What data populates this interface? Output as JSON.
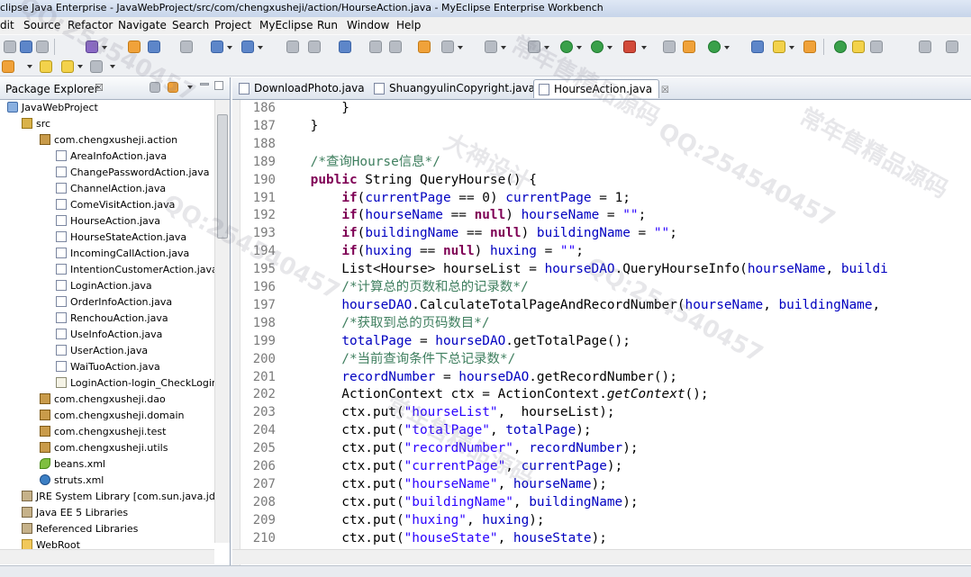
{
  "window": {
    "title": "clipse Java Enterprise - JavaWebProject/src/com/chengxusheji/action/HourseAction.java - MyEclipse Enterprise Workbench"
  },
  "menu": [
    "dit",
    "Source",
    "Refactor",
    "Navigate",
    "Search",
    "Project",
    "MyEclipse",
    "Run",
    "Window",
    "Help"
  ],
  "explorer": {
    "title": "Package Explorer",
    "close": "☒",
    "items": [
      {
        "label": "JavaWebProject",
        "icon": "project-icon",
        "indent": 0
      },
      {
        "label": "src",
        "icon": "source-folder-icon",
        "indent": 1
      },
      {
        "label": "com.chengxusheji.action",
        "icon": "package-icon",
        "indent": 2
      },
      {
        "label": "AreaInfoAction.java",
        "icon": "java-file-icon",
        "indent": 3
      },
      {
        "label": "ChangePasswordAction.java",
        "icon": "java-file-icon",
        "indent": 3
      },
      {
        "label": "ChannelAction.java",
        "icon": "java-file-icon",
        "indent": 3
      },
      {
        "label": "ComeVisitAction.java",
        "icon": "java-file-icon",
        "indent": 3
      },
      {
        "label": "HourseAction.java",
        "icon": "java-file-icon",
        "indent": 3
      },
      {
        "label": "HourseStateAction.java",
        "icon": "java-file-icon",
        "indent": 3
      },
      {
        "label": "IncomingCallAction.java",
        "icon": "java-file-icon",
        "indent": 3
      },
      {
        "label": "IntentionCustomerAction.java",
        "icon": "java-file-icon",
        "indent": 3
      },
      {
        "label": "LoginAction.java",
        "icon": "java-file-icon",
        "indent": 3
      },
      {
        "label": "OrderInfoAction.java",
        "icon": "java-file-icon",
        "indent": 3
      },
      {
        "label": "RenchouAction.java",
        "icon": "java-file-icon",
        "indent": 3
      },
      {
        "label": "UseInfoAction.java",
        "icon": "java-file-icon",
        "indent": 3
      },
      {
        "label": "UserAction.java",
        "icon": "java-file-icon",
        "indent": 3
      },
      {
        "label": "WaiTuoAction.java",
        "icon": "java-file-icon",
        "indent": 3
      },
      {
        "label": "LoginAction-login_CheckLogin",
        "icon": "xml-file-icon",
        "indent": 3
      },
      {
        "label": "com.chengxusheji.dao",
        "icon": "package-icon",
        "indent": 2
      },
      {
        "label": "com.chengxusheji.domain",
        "icon": "package-icon",
        "indent": 2
      },
      {
        "label": "com.chengxusheji.test",
        "icon": "package-icon",
        "indent": 2
      },
      {
        "label": "com.chengxusheji.utils",
        "icon": "package-icon",
        "indent": 2
      },
      {
        "label": "beans.xml",
        "icon": "bean-icon",
        "indent": 2
      },
      {
        "label": "struts.xml",
        "icon": "gear-icon",
        "indent": 2
      },
      {
        "label": "JRE System Library [com.sun.java.jdk.",
        "icon": "library-icon",
        "indent": 1
      },
      {
        "label": "Java EE 5 Libraries",
        "icon": "library-icon",
        "indent": 1
      },
      {
        "label": "Referenced Libraries",
        "icon": "library-icon",
        "indent": 1
      },
      {
        "label": "WebRoot",
        "icon": "folder-icon",
        "indent": 1
      }
    ]
  },
  "editor": {
    "tabs": [
      {
        "label": "DownloadPhoto.java",
        "active": false
      },
      {
        "label": "ShuangyulinCopyright.java",
        "active": false
      },
      {
        "label": "HourseAction.java",
        "active": true,
        "close": "☒"
      }
    ],
    "line_numbers": [
      "186",
      "187",
      "188",
      "189",
      "190",
      "191",
      "192",
      "193",
      "194",
      "195",
      "196",
      "197",
      "198",
      "199",
      "200",
      "201",
      "202",
      "203",
      "204",
      "205",
      "206",
      "207",
      "208",
      "209",
      "210"
    ],
    "lines": [
      [
        {
          "t": "        }",
          "c": ""
        }
      ],
      [
        {
          "t": "    }",
          "c": ""
        }
      ],
      [
        {
          "t": "",
          "c": ""
        }
      ],
      [
        {
          "t": "    /*查询Hourse信息*/",
          "c": "cmt"
        }
      ],
      [
        {
          "t": "    ",
          "c": ""
        },
        {
          "t": "public",
          "c": "kw"
        },
        {
          "t": " String QueryHourse() {",
          "c": ""
        }
      ],
      [
        {
          "t": "        ",
          "c": ""
        },
        {
          "t": "if",
          "c": "kw"
        },
        {
          "t": "(",
          "c": ""
        },
        {
          "t": "currentPage",
          "c": "fld"
        },
        {
          "t": " == 0) ",
          "c": ""
        },
        {
          "t": "currentPage",
          "c": "fld"
        },
        {
          "t": " = 1;",
          "c": ""
        }
      ],
      [
        {
          "t": "        ",
          "c": ""
        },
        {
          "t": "if",
          "c": "kw"
        },
        {
          "t": "(",
          "c": ""
        },
        {
          "t": "hourseName",
          "c": "fld"
        },
        {
          "t": " == ",
          "c": ""
        },
        {
          "t": "null",
          "c": "kw"
        },
        {
          "t": ") ",
          "c": ""
        },
        {
          "t": "hourseName",
          "c": "fld"
        },
        {
          "t": " = ",
          "c": ""
        },
        {
          "t": "\"\"",
          "c": "str"
        },
        {
          "t": ";",
          "c": ""
        }
      ],
      [
        {
          "t": "        ",
          "c": ""
        },
        {
          "t": "if",
          "c": "kw"
        },
        {
          "t": "(",
          "c": ""
        },
        {
          "t": "buildingName",
          "c": "fld"
        },
        {
          "t": " == ",
          "c": ""
        },
        {
          "t": "null",
          "c": "kw"
        },
        {
          "t": ") ",
          "c": ""
        },
        {
          "t": "buildingName",
          "c": "fld"
        },
        {
          "t": " = ",
          "c": ""
        },
        {
          "t": "\"\"",
          "c": "str"
        },
        {
          "t": ";",
          "c": ""
        }
      ],
      [
        {
          "t": "        ",
          "c": ""
        },
        {
          "t": "if",
          "c": "kw"
        },
        {
          "t": "(",
          "c": ""
        },
        {
          "t": "huxing",
          "c": "fld"
        },
        {
          "t": " == ",
          "c": ""
        },
        {
          "t": "null",
          "c": "kw"
        },
        {
          "t": ") ",
          "c": ""
        },
        {
          "t": "huxing",
          "c": "fld"
        },
        {
          "t": " = ",
          "c": ""
        },
        {
          "t": "\"\"",
          "c": "str"
        },
        {
          "t": ";",
          "c": ""
        }
      ],
      [
        {
          "t": "        List<Hourse> hourseList = ",
          "c": ""
        },
        {
          "t": "hourseDAO",
          "c": "fld"
        },
        {
          "t": ".QueryHourseInfo(",
          "c": ""
        },
        {
          "t": "hourseName",
          "c": "fld"
        },
        {
          "t": ", ",
          "c": ""
        },
        {
          "t": "buildi",
          "c": "fld"
        }
      ],
      [
        {
          "t": "        /*计算总的页数和总的记录数*/",
          "c": "cmt"
        }
      ],
      [
        {
          "t": "        ",
          "c": ""
        },
        {
          "t": "hourseDAO",
          "c": "fld"
        },
        {
          "t": ".CalculateTotalPageAndRecordNumber(",
          "c": ""
        },
        {
          "t": "hourseName",
          "c": "fld"
        },
        {
          "t": ", ",
          "c": ""
        },
        {
          "t": "buildingName",
          "c": "fld"
        },
        {
          "t": ",",
          "c": ""
        }
      ],
      [
        {
          "t": "        /*获取到总的页码数目*/",
          "c": "cmt"
        }
      ],
      [
        {
          "t": "        ",
          "c": ""
        },
        {
          "t": "totalPage",
          "c": "fld"
        },
        {
          "t": " = ",
          "c": ""
        },
        {
          "t": "hourseDAO",
          "c": "fld"
        },
        {
          "t": ".getTotalPage();",
          "c": ""
        }
      ],
      [
        {
          "t": "        /*当前查询条件下总记录数*/",
          "c": "cmt"
        }
      ],
      [
        {
          "t": "        ",
          "c": ""
        },
        {
          "t": "recordNumber",
          "c": "fld"
        },
        {
          "t": " = ",
          "c": ""
        },
        {
          "t": "hourseDAO",
          "c": "fld"
        },
        {
          "t": ".getRecordNumber();",
          "c": ""
        }
      ],
      [
        {
          "t": "        ActionContext ctx = ActionContext.",
          "c": ""
        },
        {
          "t": "getContext",
          "c": "it"
        },
        {
          "t": "();",
          "c": ""
        }
      ],
      [
        {
          "t": "        ctx.put(",
          "c": ""
        },
        {
          "t": "\"hourseList\"",
          "c": "str"
        },
        {
          "t": ",  hourseList);",
          "c": ""
        }
      ],
      [
        {
          "t": "        ctx.put(",
          "c": ""
        },
        {
          "t": "\"totalPage\"",
          "c": "str"
        },
        {
          "t": ", ",
          "c": ""
        },
        {
          "t": "totalPage",
          "c": "fld"
        },
        {
          "t": ");",
          "c": ""
        }
      ],
      [
        {
          "t": "        ctx.put(",
          "c": ""
        },
        {
          "t": "\"recordNumber\"",
          "c": "str"
        },
        {
          "t": ", ",
          "c": ""
        },
        {
          "t": "recordNumber",
          "c": "fld"
        },
        {
          "t": ");",
          "c": ""
        }
      ],
      [
        {
          "t": "        ctx.put(",
          "c": ""
        },
        {
          "t": "\"currentPage\"",
          "c": "str"
        },
        {
          "t": ", ",
          "c": ""
        },
        {
          "t": "currentPage",
          "c": "fld"
        },
        {
          "t": ");",
          "c": ""
        }
      ],
      [
        {
          "t": "        ctx.put(",
          "c": ""
        },
        {
          "t": "\"hourseName\"",
          "c": "str"
        },
        {
          "t": ", ",
          "c": ""
        },
        {
          "t": "hourseName",
          "c": "fld"
        },
        {
          "t": ");",
          "c": ""
        }
      ],
      [
        {
          "t": "        ctx.put(",
          "c": ""
        },
        {
          "t": "\"buildingName\"",
          "c": "str"
        },
        {
          "t": ", ",
          "c": ""
        },
        {
          "t": "buildingName",
          "c": "fld"
        },
        {
          "t": ");",
          "c": ""
        }
      ],
      [
        {
          "t": "        ctx.put(",
          "c": ""
        },
        {
          "t": "\"huxing\"",
          "c": "str"
        },
        {
          "t": ", ",
          "c": ""
        },
        {
          "t": "huxing",
          "c": "fld"
        },
        {
          "t": ");",
          "c": ""
        }
      ],
      [
        {
          "t": "        ctx.put(",
          "c": ""
        },
        {
          "t": "\"houseState\"",
          "c": "str"
        },
        {
          "t": ", ",
          "c": ""
        },
        {
          "t": "houseState",
          "c": "fld"
        },
        {
          "t": ");",
          "c": ""
        }
      ]
    ]
  },
  "watermarks": [
    "QQ:254540457",
    "常年售精品源码",
    "QQ:254540457",
    "常年售精品源码",
    "QQ:254540457",
    "大神设计",
    "QQ:254540457",
    "常年售精品源码"
  ],
  "colors": {
    "keyword": "#7f0055",
    "field": "#0000c0",
    "string": "#2a00ff",
    "comment": "#3f7f5f"
  }
}
